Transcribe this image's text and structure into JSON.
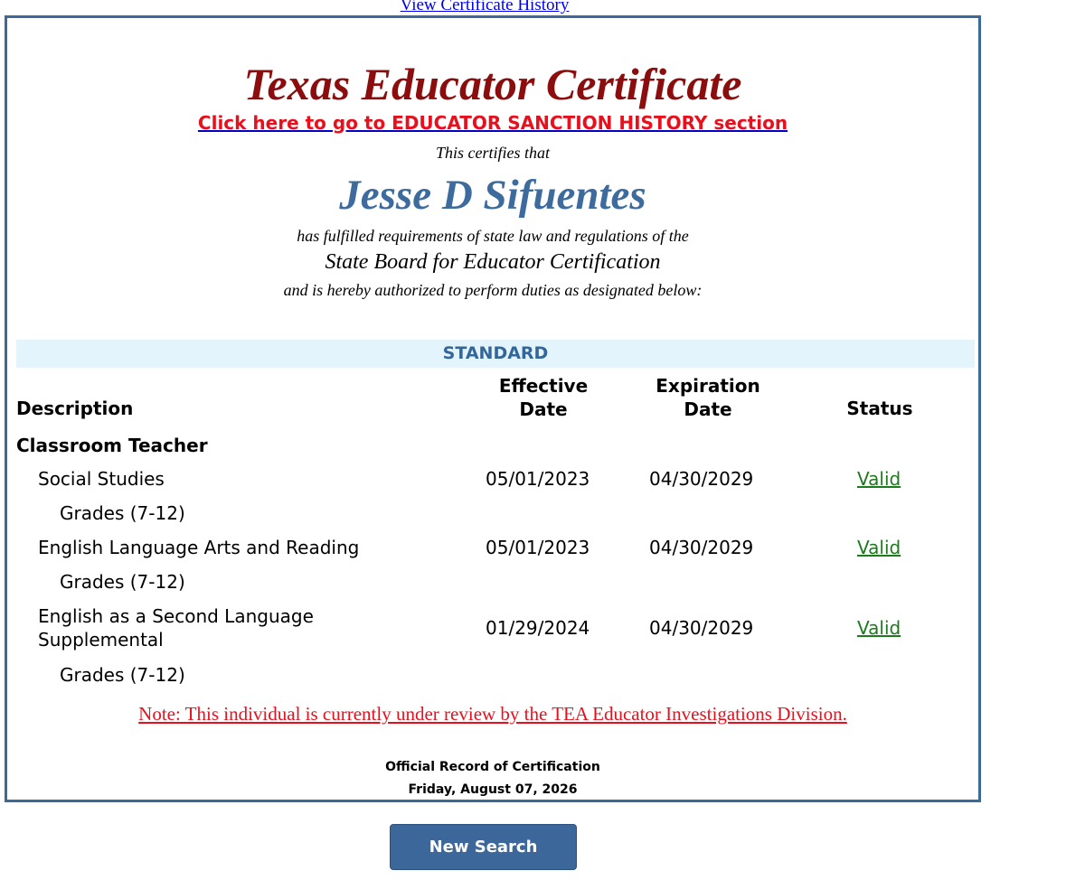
{
  "top_link": "View Certificate History",
  "certificate": {
    "title": "Texas Educator Certificate",
    "sanction_link": "Click here to go to EDUCATOR SANCTION HISTORY section",
    "certifies_text": "This certifies that",
    "person_name": "Jesse D Sifuentes",
    "fulfilled_text": "has fulfilled requirements of state law and regulations of the",
    "board_text": "State Board for Educator Certification",
    "authorized_text": "and is hereby authorized to perform duties as designated below:"
  },
  "section_label": "STANDARD",
  "table": {
    "headers": {
      "description": "Description",
      "effective_line1": "Effective",
      "effective_line2": "Date",
      "expiration_line1": "Expiration",
      "expiration_line2": "Date",
      "status": "Status"
    },
    "category": "Classroom Teacher",
    "rows": [
      {
        "subject": "Social Studies",
        "grades": "Grades (7-12)",
        "effective": "05/01/2023",
        "expiration": "04/30/2029",
        "status": "Valid"
      },
      {
        "subject": "English Language Arts and Reading",
        "grades": "Grades (7-12)",
        "effective": "05/01/2023",
        "expiration": "04/30/2029",
        "status": "Valid"
      },
      {
        "subject_line1": "English as a Second Language",
        "subject_line2": "Supplemental",
        "grades": "Grades (7-12)",
        "effective": "01/29/2024",
        "expiration": "04/30/2029",
        "status": "Valid"
      }
    ]
  },
  "note": "Note: This individual is currently under review by the TEA Educator Investigations Division.",
  "official_record": "Official Record of Certification",
  "record_date": "Friday, August 07, 2026",
  "new_search_label": "New Search",
  "colors": {
    "title_red": "#8b0d0d",
    "name_blue": "#3d6b9e",
    "border_blue": "#3b6a9a",
    "link_red": "#e8101d",
    "valid_green": "#1d7a1d",
    "standard_bg": "#e3f4fd",
    "button_blue": "#3c679a"
  }
}
